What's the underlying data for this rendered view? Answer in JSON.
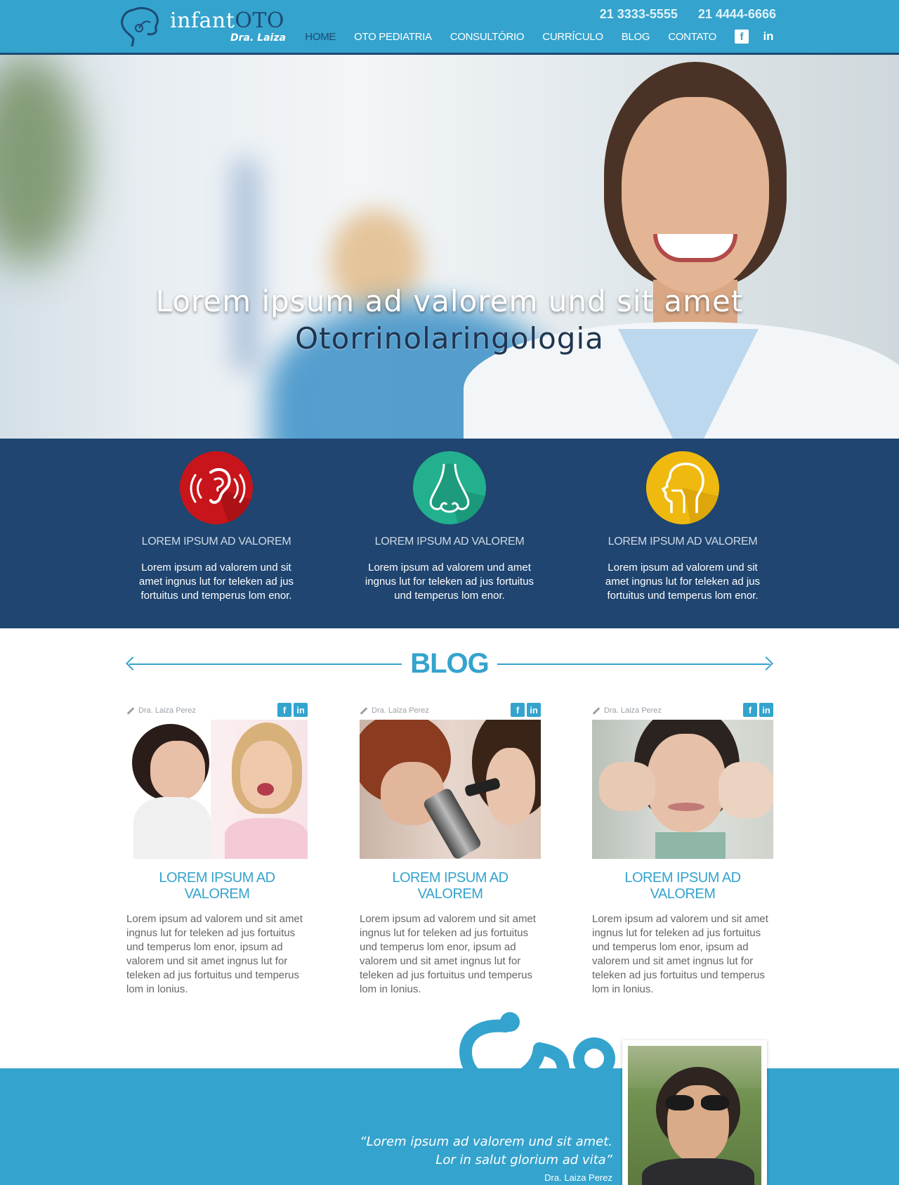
{
  "header": {
    "logo": {
      "text_main": "infant",
      "text_accent": "OTO",
      "subtitle": "Dra. Laiza"
    },
    "phones": [
      "21  3333-5555",
      "21  4444-6666"
    ],
    "nav": [
      {
        "label": "HOME",
        "active": true
      },
      {
        "label": "OTO PEDIATRIA",
        "active": false
      },
      {
        "label": "CONSULTÓRIO",
        "active": false
      },
      {
        "label": "CURRÍCULO",
        "active": false
      },
      {
        "label": "BLOG",
        "active": false
      },
      {
        "label": "CONTATO",
        "active": false
      }
    ],
    "social": {
      "facebook_icon": "f",
      "linkedin_icon": "in"
    }
  },
  "hero": {
    "line1": "Lorem ipsum ad valorem und sit amet",
    "line2": "Otorrinolaringologia"
  },
  "services": [
    {
      "icon": "ear-icon",
      "color": "#c8151b",
      "title": "LOREM IPSUM AD VALOREM",
      "text": "Lorem ipsum ad valorem und sit amet ingnus lut for teleken ad jus fortuitus und temperus lom enor."
    },
    {
      "icon": "nose-icon",
      "color": "#23b08e",
      "title": "LOREM IPSUM AD VALOREM",
      "text": "Lorem ipsum ad valorem und amet ingnus lut for teleken ad jus fortuitus und temperus lom enor."
    },
    {
      "icon": "throat-icon",
      "color": "#f0b90f",
      "title": "LOREM IPSUM AD VALOREM",
      "text": "Lorem ipsum ad valorem und sit amet ingnus lut for teleken ad jus fortuitus und temperus lom enor."
    }
  ],
  "blog": {
    "title": "BLOG",
    "posts": [
      {
        "author": "Dra. Laiza Perez",
        "title": "LOREM IPSUM AD VALOREM",
        "text": "Lorem ipsum ad valorem und sit amet ingnus lut for teleken ad jus fortuitus und temperus lom enor, ipsum ad valorem und sit amet ingnus lut for teleken ad jus fortuitus und temperus lom in lonius.",
        "image": "doctor-examining-child-throat"
      },
      {
        "author": "Dra. Laiza Perez",
        "title": "LOREM IPSUM AD VALOREM",
        "text": "Lorem ipsum ad valorem und sit amet ingnus lut for teleken ad jus fortuitus und temperus lom enor, ipsum ad valorem und sit amet ingnus lut for teleken ad jus fortuitus und temperus lom in lonius.",
        "image": "otoscope-ear-exam"
      },
      {
        "author": "Dra. Laiza Perez",
        "title": "LOREM IPSUM AD VALOREM",
        "text": "Lorem ipsum ad valorem und sit amet ingnus lut for teleken ad jus fortuitus und temperus lom enor, ipsum ad valorem und sit amet ingnus lut for teleken ad jus fortuitus und temperus lom in lonius.",
        "image": "woman-nose-exam"
      }
    ]
  },
  "testimonial": {
    "quote_line1": "“Lorem ipsum ad valorem und sit amet.",
    "quote_line2": "Lor in salut glorium ad vita”",
    "author": "Dra. Laiza Perez"
  },
  "colors": {
    "primary": "#34a3cd",
    "dark": "#1f4570",
    "ear": "#c8151b",
    "nose": "#23b08e",
    "throat": "#f0b90f"
  }
}
